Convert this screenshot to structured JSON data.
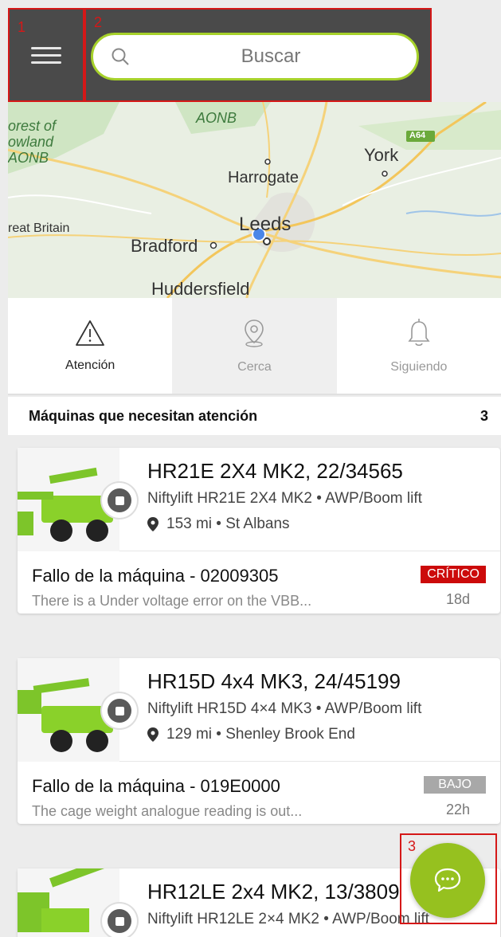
{
  "header": {
    "search_placeholder": "Buscar"
  },
  "annotations": [
    "1",
    "2",
    "3"
  ],
  "map": {
    "labels": [
      "AONB",
      "orest of",
      "owland",
      "AONB",
      "York",
      "A64",
      "Harrogate",
      "Leeds",
      "reat Britain",
      "Bradford",
      "Huddersfield"
    ]
  },
  "tabs": [
    {
      "label": "Atención",
      "icon": "warning-icon",
      "active": true
    },
    {
      "label": "Cerca",
      "icon": "location-pin-icon",
      "active": false
    },
    {
      "label": "Siguiendo",
      "icon": "bell-icon",
      "active": false
    }
  ],
  "section": {
    "title": "Máquinas que necesitan atención",
    "count": "3"
  },
  "cards": [
    {
      "title": "HR21E 2X4 MK2, 22/34565",
      "subtitle": "Niftylift HR21E 2X4 MK2 • AWP/Boom lift",
      "location": "153 mi • St Albans",
      "fault": "Fallo de la máquina - 02009305",
      "description": "There is a Under voltage error on the VBB...",
      "badge": "CRÍTICO",
      "badge_color": "#cc0a0a",
      "age": "18d"
    },
    {
      "title": "HR15D 4x4 MK3, 24/45199",
      "subtitle": "Niftylift HR15D 4×4 MK3 • AWP/Boom lift",
      "location": "129 mi • Shenley Brook End",
      "fault": "Fallo de la máquina - 019E0000",
      "description": "The cage weight analogue reading is out...",
      "badge": "BAJO",
      "badge_color": "#a8a8a8",
      "age": "22h"
    },
    {
      "title": "HR12LE 2x4 MK2, 13/3809",
      "subtitle": "Niftylift HR12LE 2×4 MK2 • AWP/Boom lift"
    }
  ],
  "colors": {
    "accent": "#96c11f",
    "topbar": "#4a4a4a",
    "critical": "#cc0a0a",
    "low": "#a8a8a8"
  }
}
